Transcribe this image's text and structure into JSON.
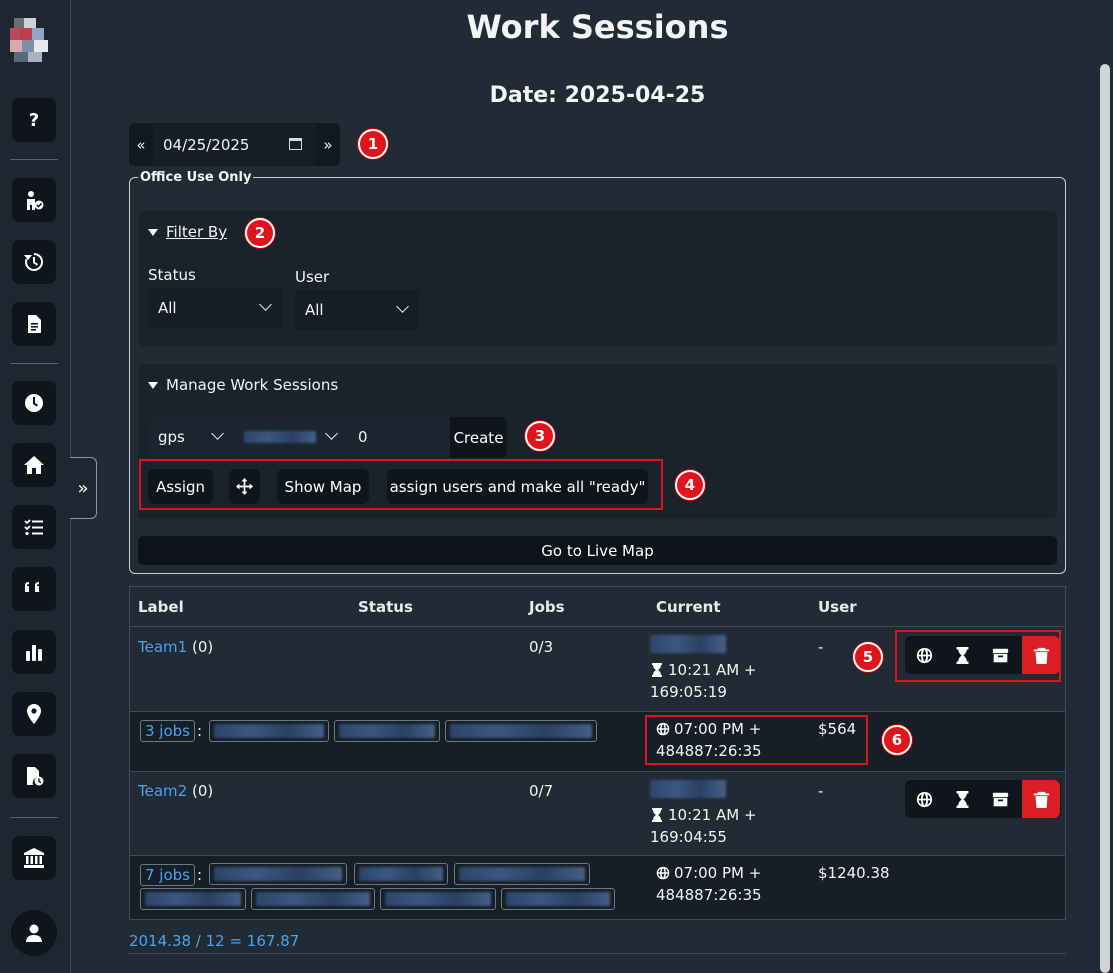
{
  "page": {
    "title": "Work Sessions",
    "date_heading": "Date: 2025-04-25"
  },
  "date_nav": {
    "prev": "«",
    "next": "»",
    "date_value": "04/25/2025"
  },
  "office": {
    "legend": "Office Use Only",
    "filter": {
      "heading": "Filter By",
      "status_label": "Status",
      "status_value": "All",
      "user_label": "User",
      "user_value": "All"
    },
    "manage": {
      "heading": "Manage Work Sessions",
      "type_value": "gps",
      "count_value": "0",
      "create_label": "Create",
      "assign_label": "Assign",
      "show_map_label": "Show Map",
      "assign_ready_label": "assign users and make all \"ready\""
    },
    "live_map_label": "Go to Live Map"
  },
  "badges": [
    "1",
    "2",
    "3",
    "4",
    "5",
    "6"
  ],
  "table": {
    "headers": [
      "Label",
      "Status",
      "Jobs",
      "Current",
      "User"
    ],
    "rows": [
      {
        "team": "Team1",
        "count": "(0)",
        "jobs": "0/3",
        "time": "10:21 AM +",
        "duration": "169:05:19",
        "user": "-",
        "jobs_link": "3 jobs",
        "sep": ":",
        "sub_time": "07:00 PM +",
        "sub_duration": "484887:26:35",
        "amount": "$564"
      },
      {
        "team": "Team2",
        "count": "(0)",
        "jobs": "0/7",
        "time": "10:21 AM +",
        "duration": "169:04:55",
        "user": "-",
        "jobs_link": "7 jobs",
        "sep": ":",
        "sub_time": "07:00 PM +",
        "sub_duration": "484887:26:35",
        "amount": "$1240.38"
      }
    ]
  },
  "summary": "2014.38 / 12 = 167.87",
  "icons": {
    "sidebar": [
      "help-icon",
      "user-check-icon",
      "history-icon",
      "document-icon",
      "clock-icon",
      "home-icon",
      "checklist-icon",
      "quote-icon",
      "bar-chart-icon",
      "location-pin-icon",
      "file-clock-icon",
      "bank-icon",
      "user-icon"
    ],
    "row_actions": [
      "globe-icon",
      "hourglass-icon",
      "archive-icon",
      "trash-icon"
    ]
  },
  "colors": {
    "accent_red": "#dc1f26",
    "link_blue": "#4aa3f0",
    "background": "#212b36"
  }
}
